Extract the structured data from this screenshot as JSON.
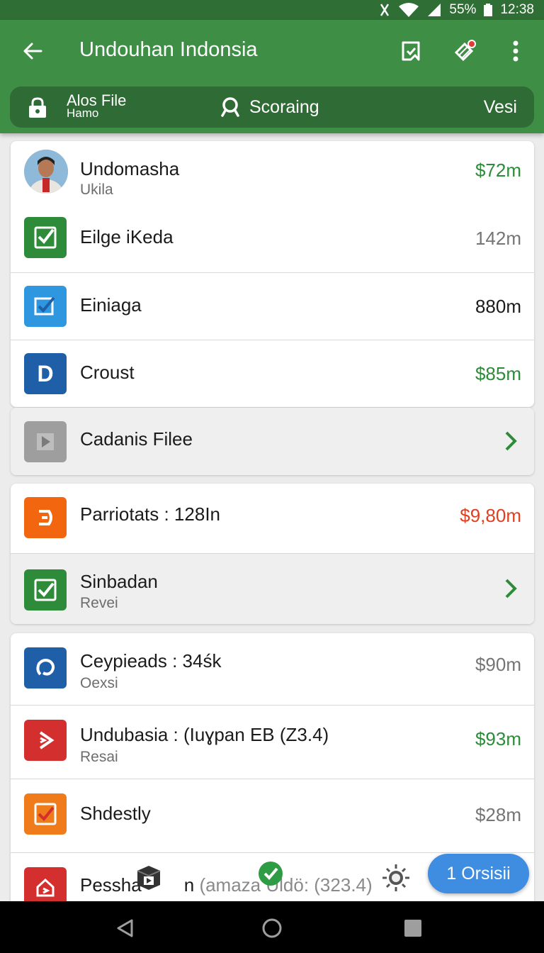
{
  "status_bar": {
    "battery": "55%",
    "time": "12:38"
  },
  "app_bar": {
    "title": "Undouhan Indonsia",
    "subbar": {
      "left_title": "Alos File",
      "left_sub": "Hamo",
      "center": "Scoraing",
      "right": "Vesi"
    }
  },
  "items": [
    {
      "title": "Undomasha",
      "subtitle": "Ukila",
      "value": "$72m",
      "icon": "avatar",
      "value_color": "#2e8b3a"
    },
    {
      "title": "Eilge iKeda",
      "value": "142m",
      "icon": "check-doc-icon",
      "value_color": "#757575"
    },
    {
      "title": "Einiaga",
      "value": "880m",
      "icon": "blue-check-doc-icon",
      "value_color": "#1b1b1b"
    },
    {
      "title": "Croust",
      "value": "$85m",
      "icon": "d-letter-icon",
      "value_color": "#2e8b3a"
    },
    {
      "title": "Cadanis Filee",
      "icon": "play-doc-icon"
    },
    {
      "title": "Parriotats : 128In",
      "value": "$9,80m",
      "icon": "orange-doc-icon",
      "value_color": "#e0401f"
    },
    {
      "title": "Sinbadan",
      "subtitle": "Revei",
      "icon": "green-check-icon"
    },
    {
      "title": "Ceypieads : 34śk",
      "subtitle": "Oexsi",
      "value": "$90m",
      "icon": "blue-circle-icon",
      "value_color": "#757575"
    },
    {
      "title": "Undubasia : (Iuɣpan EB (Z3.4)",
      "subtitle": "Resai",
      "value": "$93m",
      "icon": "red-doc-icon",
      "value_color": "#2e8b3a"
    },
    {
      "title": "Shdestly",
      "value": "$28m",
      "icon": "orange-check-icon",
      "value_color": "#757575"
    },
    {
      "title": "Pessha",
      "title_suffix": "n",
      "extra": "(amaza Uldö: (323.4)",
      "icon": "red-home-doc-icon"
    }
  ],
  "fab": {
    "label": "1 Orsisii"
  },
  "colors": {
    "primary": "#3e8e45",
    "primary_dark": "#2f6e34",
    "accent": "#3f8de0"
  }
}
